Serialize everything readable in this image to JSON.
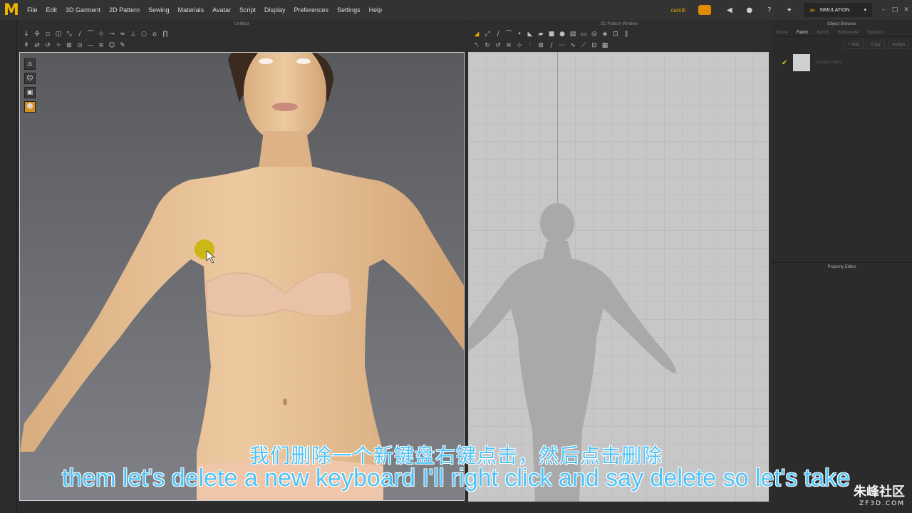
{
  "app": {
    "logo": "M",
    "user": "camili",
    "mode": "SIMULATION"
  },
  "menu": [
    "File",
    "Edit",
    "3D Garment",
    "2D Pattern",
    "Sewing",
    "Materials",
    "Avatar",
    "Script",
    "Display",
    "Preferences",
    "Settings",
    "Help"
  ],
  "window3d": {
    "title": "Untitled"
  },
  "window2d": {
    "title": "2D Pattern Window"
  },
  "object_browser": {
    "title": "Object Browser",
    "tabs": [
      "Scene",
      "Fabric",
      "Button",
      "Buttonhole",
      "Topstitch"
    ],
    "active_tab": "Fabric",
    "actions": [
      "+ Add",
      "Copy",
      "Assign"
    ],
    "fabric": "Default Fabric"
  },
  "property_editor": {
    "title": "Property Editor"
  },
  "subtitles": {
    "cn": "我们删除一个新键盘右键点击，然后点击删除",
    "en": "them let's delete a new keyboard I'll right click and say delete so let's take"
  },
  "watermark": {
    "cn": "朱峰社区",
    "en": "ZF3D.COM"
  },
  "colors": {
    "accent": "#e8a400",
    "subtitle": "#4fc3f7",
    "skin": "#e9c39a"
  }
}
